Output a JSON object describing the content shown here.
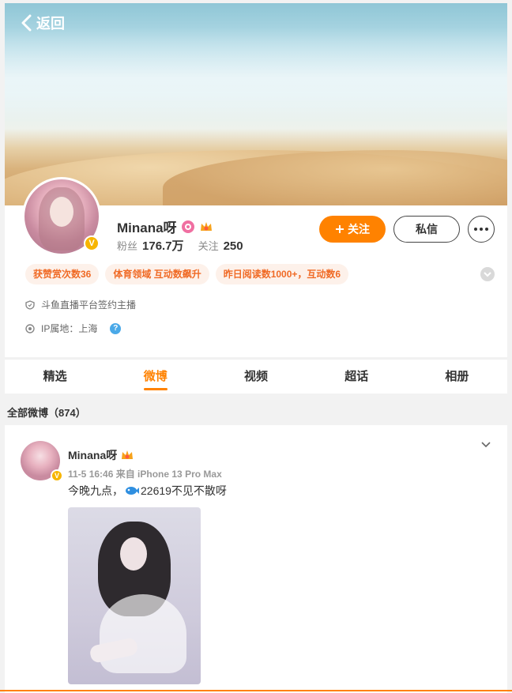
{
  "nav": {
    "back_label": "返回"
  },
  "profile": {
    "name": "Minana呀",
    "fans_label": "粉丝",
    "fans_value": "176.7万",
    "follow_label": "关注",
    "follow_value": "250",
    "follow_button": "关注",
    "message_button": "私信",
    "tags": [
      "获赞赏次数36",
      "体育领域 互动数飙升",
      "昨日阅读数1000+，互动数6"
    ],
    "verify_text": "斗鱼直播平台签约主播",
    "ip_text": "IP属地：上海",
    "help_glyph": "?"
  },
  "tabs": [
    {
      "label": "精选",
      "active": false
    },
    {
      "label": "微博",
      "active": true
    },
    {
      "label": "视频",
      "active": false
    },
    {
      "label": "超话",
      "active": false
    },
    {
      "label": "相册",
      "active": false
    }
  ],
  "feed": {
    "section_title": "全部微博（874）",
    "post": {
      "author": "Minana呀",
      "meta": "11-5 16:46 来自 iPhone 13 Pro Max",
      "text_before": "今晚九点，",
      "text_after": "22619不见不散呀"
    }
  },
  "colors": {
    "accent": "#ff8200",
    "tag_bg": "#fdf1ea",
    "tag_text": "#f06a25",
    "verified": "#f7b500"
  }
}
